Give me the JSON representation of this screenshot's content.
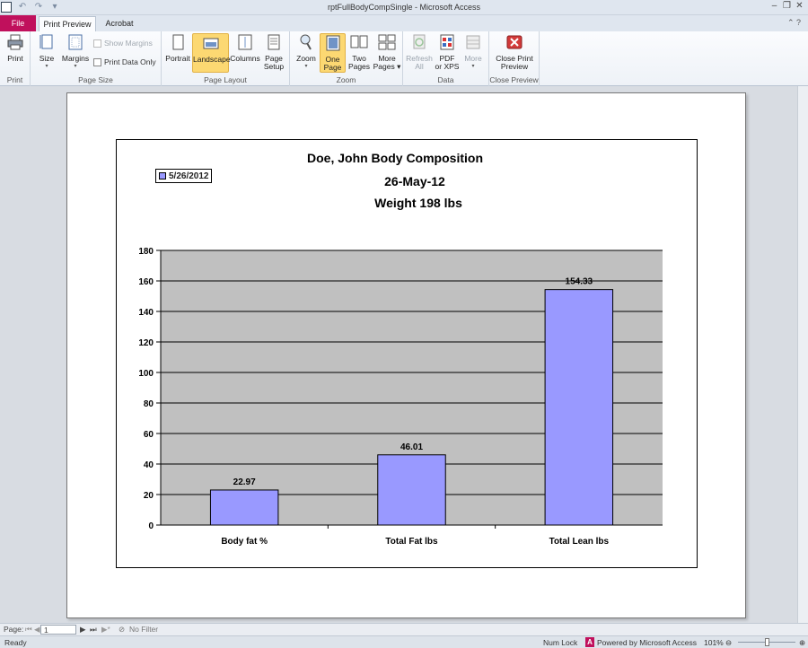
{
  "window": {
    "title": "rptFullBodyCompSingle - Microsoft Access"
  },
  "tabs": {
    "file": "File",
    "print_preview": "Print Preview",
    "acrobat": "Acrobat"
  },
  "ribbon": {
    "print": {
      "print": "Print",
      "group": "Print"
    },
    "page_size": {
      "size": "Size",
      "margins": "Margins",
      "show_margins": "Show Margins",
      "print_data_only": "Print Data Only",
      "group": "Page Size"
    },
    "page_layout": {
      "portrait": "Portrait",
      "landscape": "Landscape",
      "columns": "Columns",
      "page_setup_1": "Page",
      "page_setup_2": "Setup",
      "group": "Page Layout"
    },
    "zoom": {
      "zoom": "Zoom",
      "one_page_1": "One",
      "one_page_2": "Page",
      "two_pages_1": "Two",
      "two_pages_2": "Pages",
      "more_pages_1": "More",
      "more_pages_2": "Pages",
      "group": "Zoom"
    },
    "data": {
      "refresh_1": "Refresh",
      "refresh_2": "All",
      "pdf_1": "PDF",
      "pdf_2": "or XPS",
      "more": "More",
      "group": "Data"
    },
    "close": {
      "close_1": "Close Print",
      "close_2": "Preview",
      "group": "Close Preview"
    }
  },
  "report": {
    "title_line1": "Doe, John Body Composition",
    "title_line2": "26-May-12",
    "title_line3": "Weight 198  lbs",
    "legend_label": "5/26/2012"
  },
  "colors": {
    "bar_fill": "#9999ff",
    "plot_bg": "#c0c0c0"
  },
  "chart_data": {
    "type": "bar",
    "categories": [
      "Body fat %",
      "Total Fat lbs",
      "Total Lean lbs"
    ],
    "series": [
      {
        "name": "5/26/2012",
        "values": [
          22.97,
          46.01,
          154.33
        ]
      }
    ],
    "data_labels": [
      "22.97",
      "46.01",
      "154.33"
    ],
    "ylim": [
      0,
      180
    ],
    "yticks": [
      0,
      20,
      40,
      60,
      80,
      100,
      120,
      140,
      160,
      180
    ],
    "grid": true,
    "legend": "top-left"
  },
  "navbar": {
    "page_label": "Page:",
    "page_value": "1",
    "filter": "No Filter"
  },
  "status": {
    "ready": "Ready",
    "num_lock": "Num Lock",
    "powered": "Powered by Microsoft Access",
    "zoom_level": "101%"
  }
}
